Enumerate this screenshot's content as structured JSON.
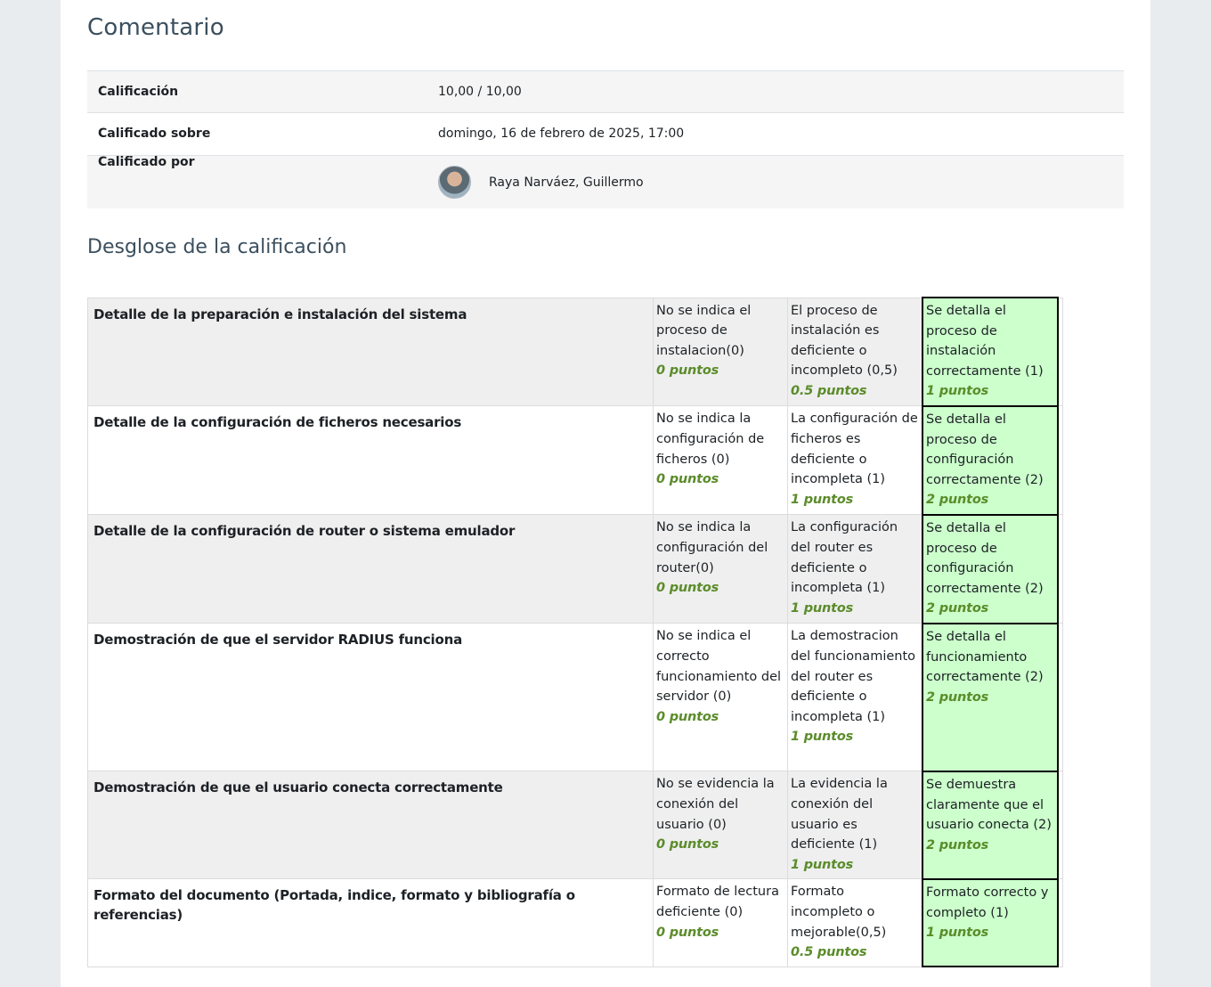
{
  "feedback": {
    "heading": "Comentario",
    "rows": [
      {
        "label": "Calificación",
        "value": "10,00 / 10,00"
      },
      {
        "label": "Calificado sobre",
        "value": "domingo, 16 de febrero de 2025, 17:00"
      },
      {
        "label": "Calificado por",
        "value": "Raya Narváez, Guillermo"
      }
    ]
  },
  "rubric": {
    "heading": "Desglose de la calificación",
    "criteria": [
      {
        "description": "Detalle de la preparación e instalación del sistema",
        "levels": [
          {
            "definition": "No se indica el proceso de instalacion(0)",
            "score": "0 puntos"
          },
          {
            "definition": "El proceso de instalación es deficiente o incompleto (0,5)",
            "score": "0.5 puntos"
          },
          {
            "definition": "Se detalla el proceso de instalación correctamente (1)",
            "score": "1 puntos"
          }
        ]
      },
      {
        "description": "Detalle de la configuración de ficheros necesarios",
        "levels": [
          {
            "definition": "No se indica la configuración de ficheros (0)",
            "score": "0 puntos"
          },
          {
            "definition": "La configuración de ficheros es deficiente o incompleta (1)",
            "score": "1 puntos"
          },
          {
            "definition": "Se detalla el proceso de configuración correctamente (2)",
            "score": "2 puntos"
          }
        ]
      },
      {
        "description": "Detalle de la configuración de router o sistema emulador",
        "levels": [
          {
            "definition": "No se indica la configuración del router(0)",
            "score": "0 puntos"
          },
          {
            "definition": "La configuración del router es deficiente o incompleta (1)",
            "score": "1 puntos"
          },
          {
            "definition": "Se detalla el proceso de configuración correctamente (2)",
            "score": "2 puntos"
          }
        ]
      },
      {
        "description": "Demostración de que el servidor RADIUS funciona",
        "levels": [
          {
            "definition": "No se indica el correcto funcionamiento del servidor (0)",
            "score": "0 puntos"
          },
          {
            "definition": "La demostracion del funcionamiento del router es deficiente o incompleta (1)",
            "score": "1 puntos"
          },
          {
            "definition": "Se detalla el funcionamiento correctamente (2)",
            "score": "2 puntos"
          }
        ]
      },
      {
        "description": "Demostración de que el usuario conecta correctamente",
        "levels": [
          {
            "definition": "No se evidencia la conexión del usuario (0)",
            "score": "0 puntos"
          },
          {
            "definition": "La evidencia la conexión del usuario es deficiente (1)",
            "score": "1 puntos"
          },
          {
            "definition": "Se demuestra claramente que el usuario conecta (2)",
            "score": "2 puntos"
          }
        ]
      },
      {
        "description": "Formato del documento (Portada, indice, formato y bibliografía o referencias)",
        "levels": [
          {
            "definition": "Formato de lectura deficiente (0)",
            "score": "0 puntos"
          },
          {
            "definition": "Formato incompleto o mejorable(0,5)",
            "score": "0.5 puntos"
          },
          {
            "definition": "Formato correcto y completo (1)",
            "score": "1 puntos"
          }
        ]
      }
    ]
  }
}
